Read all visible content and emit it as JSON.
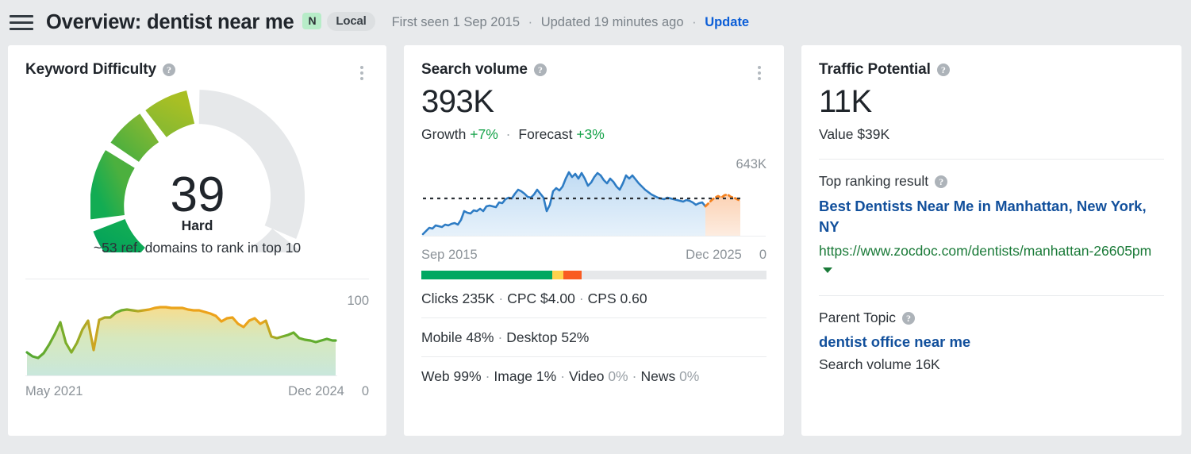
{
  "header": {
    "menu_icon": "hamburger-icon",
    "title": "Overview: dentist near me",
    "badge_new": "N",
    "badge_local": "Local",
    "first_seen": "First seen 1 Sep 2015",
    "updated": "Updated 19 minutes ago",
    "update_link": "Update",
    "separator": "·"
  },
  "keyword_difficulty": {
    "title": "Keyword Difficulty",
    "help_icon": "question-mark-icon",
    "menu_icon": "kebab-menu-icon",
    "score": "39",
    "rating": "Hard",
    "subtext": "~53 ref. domains to rank in top 10",
    "axis_max": "100",
    "axis_min": "0",
    "axis_start": "May 2021",
    "axis_end": "Dec 2024"
  },
  "search_volume": {
    "title": "Search volume",
    "help_icon": "question-mark-icon",
    "menu_icon": "kebab-menu-icon",
    "value": "393K",
    "growth_label": "Growth",
    "growth_value": "+7%",
    "forecast_label": "Forecast",
    "forecast_value": "+3%",
    "axis_max": "643K",
    "axis_min": "0",
    "axis_start": "Sep 2015",
    "axis_end": "Dec 2025",
    "rows": [
      {
        "name": "clicks-row",
        "parts": [
          "Clicks 235K",
          "CPC $4.00",
          "CPS 0.60"
        ]
      },
      {
        "name": "device-row",
        "parts": [
          "Mobile 48%",
          "Desktop 52%"
        ]
      }
    ],
    "serp_row": [
      {
        "label": "Web",
        "value": "99%",
        "muted": false
      },
      {
        "label": "Image",
        "value": "1%",
        "muted": false
      },
      {
        "label": "Video",
        "value": "0%",
        "muted": true
      },
      {
        "label": "News",
        "value": "0%",
        "muted": true
      }
    ],
    "clicks_bar": [
      {
        "label": "organic-clicks",
        "percent": 38.0,
        "color": "#00a862"
      },
      {
        "label": "paid-clicks",
        "percent": 3.2,
        "color": "#ffd24d"
      },
      {
        "label": "no-clicks",
        "percent": 5.2,
        "color": "#f95b21"
      },
      {
        "label": "remainder",
        "percent": 53.6,
        "color": "#e6e8ea"
      }
    ]
  },
  "traffic_potential": {
    "title": "Traffic Potential",
    "help_icon": "question-mark-icon",
    "value": "11K",
    "value_sub": "Value $39K",
    "top_ranking_label": "Top ranking result",
    "top_ranking_title": "Best Dentists Near Me in Manhattan, New York, NY",
    "top_ranking_url": "https://www.zocdoc.com/dentists/manhattan-26605pm",
    "caret_icon": "chevron-down-icon",
    "parent_topic_label": "Parent Topic",
    "parent_topic": "dentist office near me",
    "parent_topic_volume": "Search volume 16K"
  },
  "chart_data": [
    {
      "id": "kd-gauge",
      "type": "pie",
      "title": "Keyword Difficulty gauge",
      "value": 39,
      "range": [
        0,
        100
      ],
      "label": "Hard",
      "segments": [
        {
          "name": "0-10",
          "from": 0,
          "to": 10,
          "color": "#00a862"
        },
        {
          "name": "11-20",
          "from": 11,
          "to": 20,
          "color": "#35a83f"
        },
        {
          "name": "21-30",
          "from": 21,
          "to": 30,
          "color": "#62b03a"
        },
        {
          "name": "31-39",
          "from": 31,
          "to": 39,
          "color": "#9cbb29"
        },
        {
          "name": "remainder",
          "from": 39,
          "to": 100,
          "color": "#e6e8ea"
        }
      ]
    },
    {
      "id": "kd-history",
      "type": "area",
      "title": "Keyword Difficulty over time",
      "xlabel": "",
      "ylabel": "",
      "ylim": [
        0,
        100
      ],
      "x_start": "May 2021",
      "x_end": "Dec 2024",
      "grid": false,
      "series": [
        {
          "name": "Keyword Difficulty",
          "values": [
            36,
            33,
            32,
            36,
            44,
            52,
            62,
            48,
            40,
            46,
            55,
            62,
            37,
            62,
            64,
            64,
            68,
            70,
            71,
            70,
            69,
            70,
            71,
            72,
            73,
            73,
            72,
            72,
            72,
            71,
            70,
            70,
            69,
            68,
            66,
            62,
            64,
            65,
            60,
            58,
            62,
            64,
            60,
            62,
            50,
            49,
            50,
            51,
            53,
            49,
            48,
            47,
            46,
            47,
            48,
            47
          ]
        }
      ]
    },
    {
      "id": "sv-history",
      "type": "area",
      "title": "Search volume over time",
      "xlabel": "",
      "ylabel": "",
      "ylim": [
        0,
        643000
      ],
      "y_max_label": "643K",
      "x_start": "Sep 2015",
      "x_end": "Dec 2025",
      "grid": false,
      "baseline_value": 393000,
      "baseline_style": "dashed",
      "series": [
        {
          "name": "Search volume",
          "color": "#2e7cc4",
          "values": [
            120,
            150,
            180,
            175,
            200,
            195,
            185,
            205,
            200,
            210,
            215,
            205,
            235,
            300,
            290,
            280,
            305,
            300,
            320,
            300,
            335,
            340,
            335,
            330,
            365,
            360,
            385,
            395,
            390,
            420,
            450,
            440,
            420,
            400,
            395,
            415,
            450,
            420,
            390,
            300,
            345,
            430,
            455,
            440,
            470,
            520,
            565,
            530,
            555,
            520,
            560,
            520,
            470,
            490,
            530,
            560,
            540,
            510,
            490,
            520,
            500,
            470,
            450,
            490,
            540,
            520,
            540,
            515,
            540,
            520,
            490,
            470,
            455,
            440,
            420,
            410,
            400,
            395,
            405,
            400,
            395,
            390,
            385,
            380,
            390,
            385,
            375,
            360,
            370,
            375
          ]
        },
        {
          "name": "Forecast",
          "color": "#f58220",
          "style": "dashed",
          "values": [
            375,
            385,
            400,
            405,
            415,
            400,
            415,
            420,
            405,
            400,
            395,
            390
          ]
        }
      ]
    }
  ]
}
